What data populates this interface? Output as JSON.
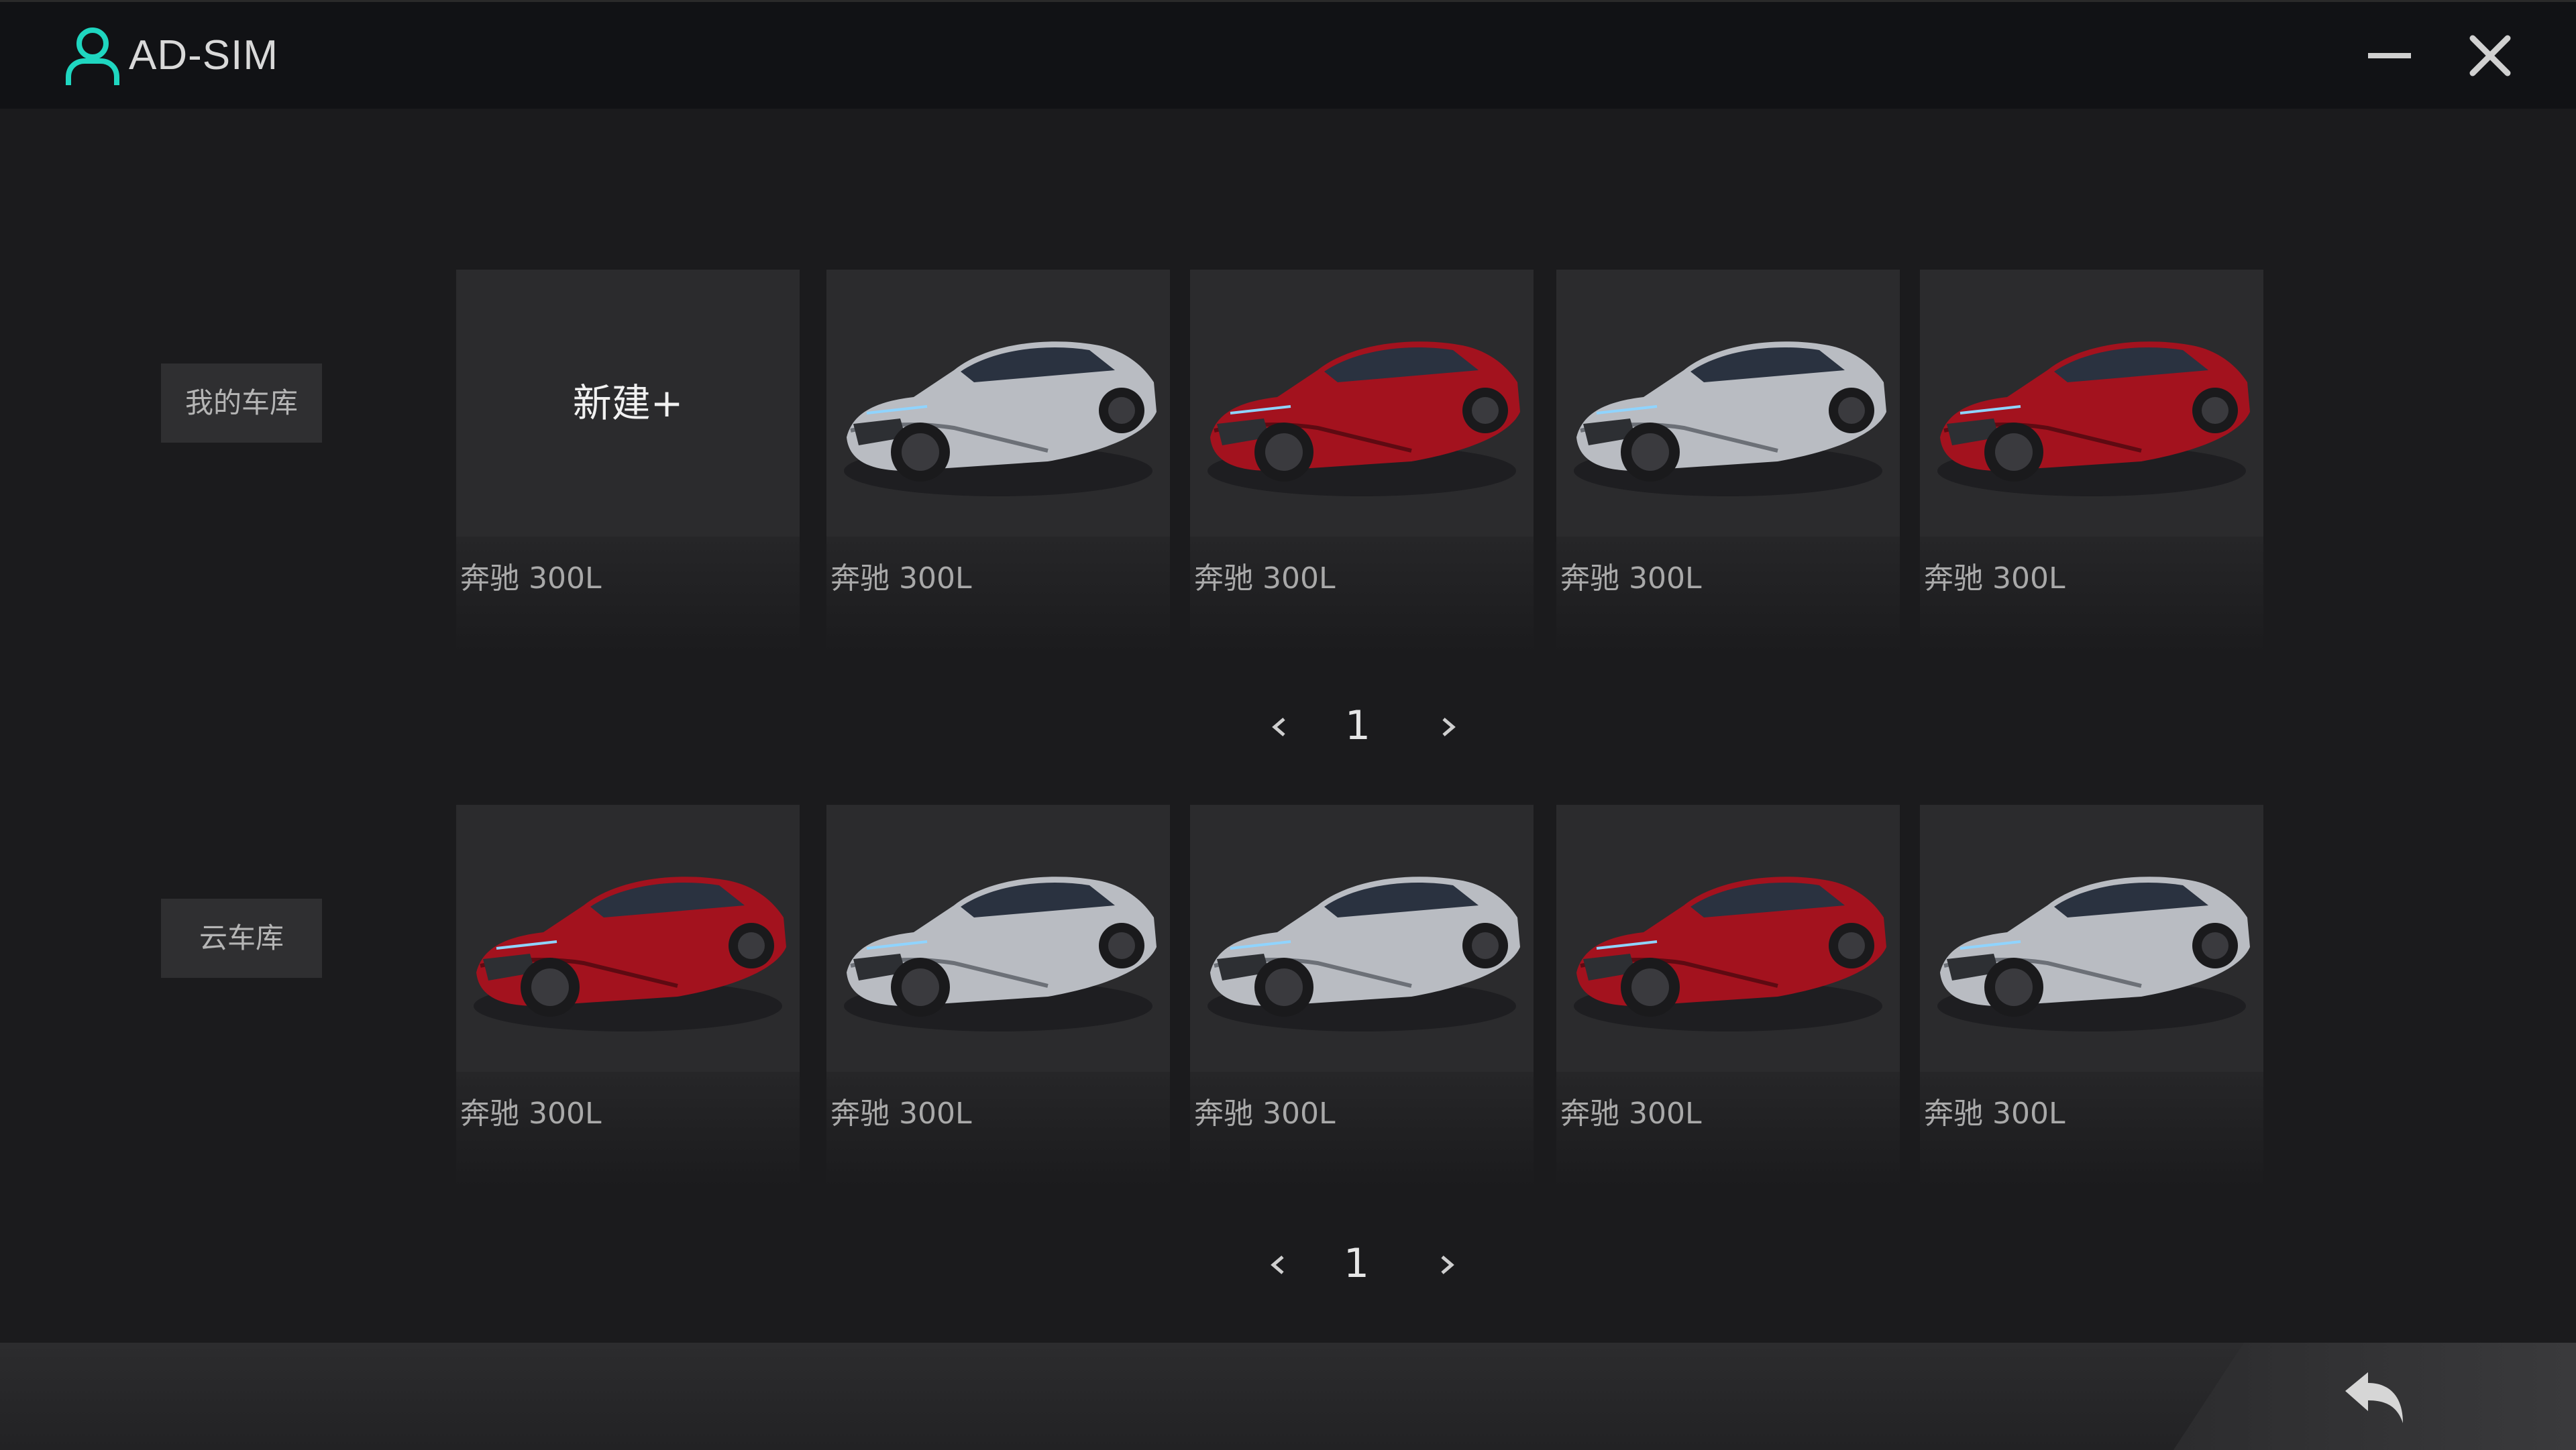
{
  "app": {
    "title": "AD-SIM",
    "accent_color": "#1fd6c0"
  },
  "window_controls": {
    "minimize_icon": "minimize-icon",
    "close_icon": "close-icon"
  },
  "my_garage": {
    "tab_label": "我的车库",
    "new_label": "新建+",
    "cards": [
      {
        "label": "奔驰 300L",
        "image": "new"
      },
      {
        "label": "奔驰 300L",
        "image": "silver"
      },
      {
        "label": "奔驰 300L",
        "image": "red"
      },
      {
        "label": "奔驰 300L",
        "image": "silver"
      },
      {
        "label": "奔驰 300L",
        "image": "red"
      }
    ],
    "page": "1"
  },
  "cloud_garage": {
    "tab_label": "云车库",
    "cards": [
      {
        "label": "奔驰 300L",
        "image": "red"
      },
      {
        "label": "奔驰 300L",
        "image": "silver"
      },
      {
        "label": "奔驰 300L",
        "image": "silver"
      },
      {
        "label": "奔驰 300L",
        "image": "red"
      },
      {
        "label": "奔驰 300L",
        "image": "silver"
      }
    ],
    "page": "1"
  },
  "car_colors": {
    "silver": "#b9bcc2",
    "red": "#a3121e"
  },
  "bottom": {
    "back_icon": "back-arrow-icon"
  }
}
